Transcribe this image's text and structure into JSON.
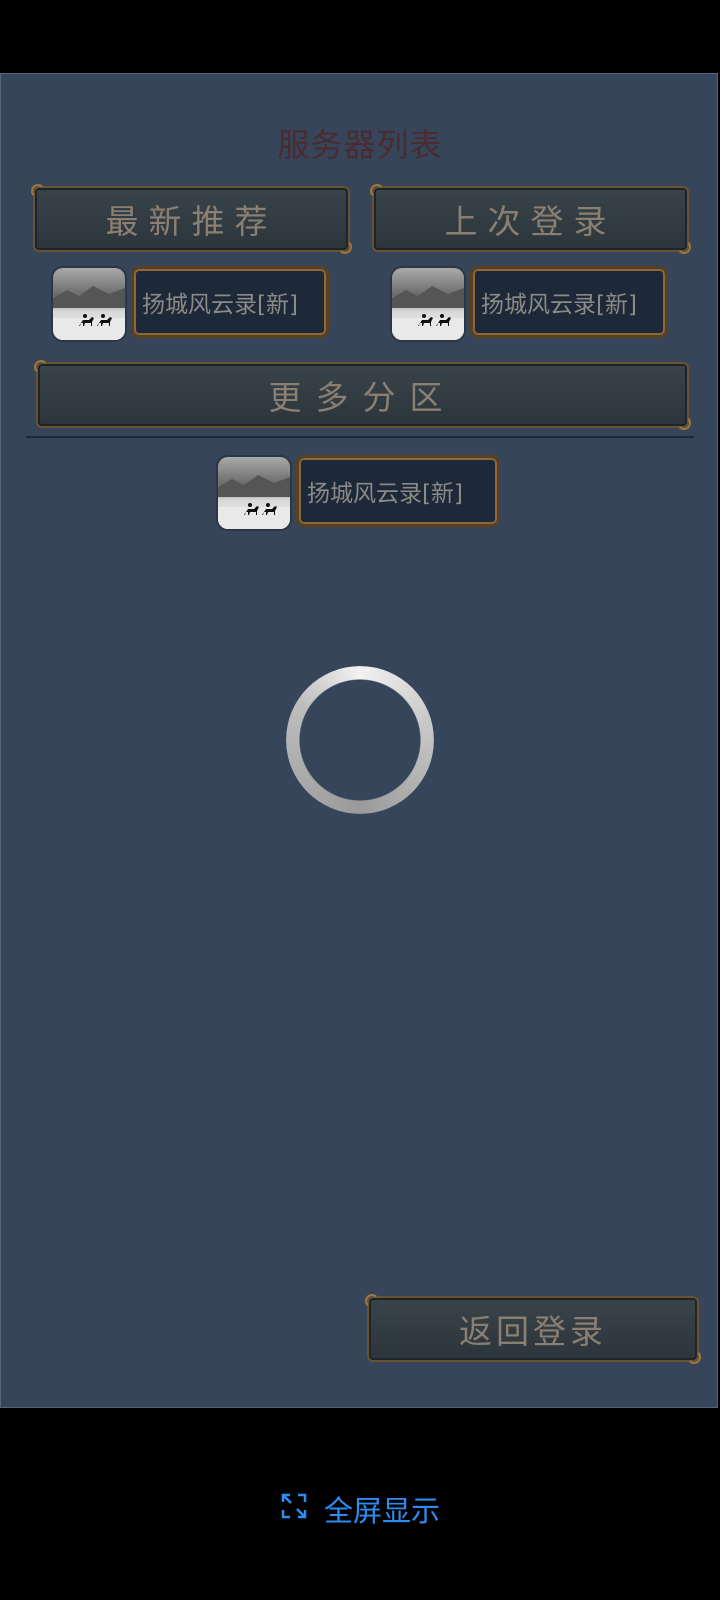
{
  "title": "服务器列表",
  "tabs": {
    "recommended": "最新推荐",
    "last_login": "上次登录",
    "more_zones": "更多分区"
  },
  "servers": {
    "recommended": [
      {
        "name": "扬城风云录[新]"
      }
    ],
    "last_login": [
      {
        "name": "扬城风云录[新]"
      }
    ],
    "more": [
      {
        "name": "扬城风云录[新]"
      }
    ]
  },
  "back_button": "返回登录",
  "fullscreen": {
    "label": "全屏显示",
    "icon": "fullscreen-icon",
    "color": "#2d8cf0"
  },
  "colors": {
    "panel": "#364559",
    "title": "#4a2b2f",
    "tab_text": "#8a7f70"
  }
}
